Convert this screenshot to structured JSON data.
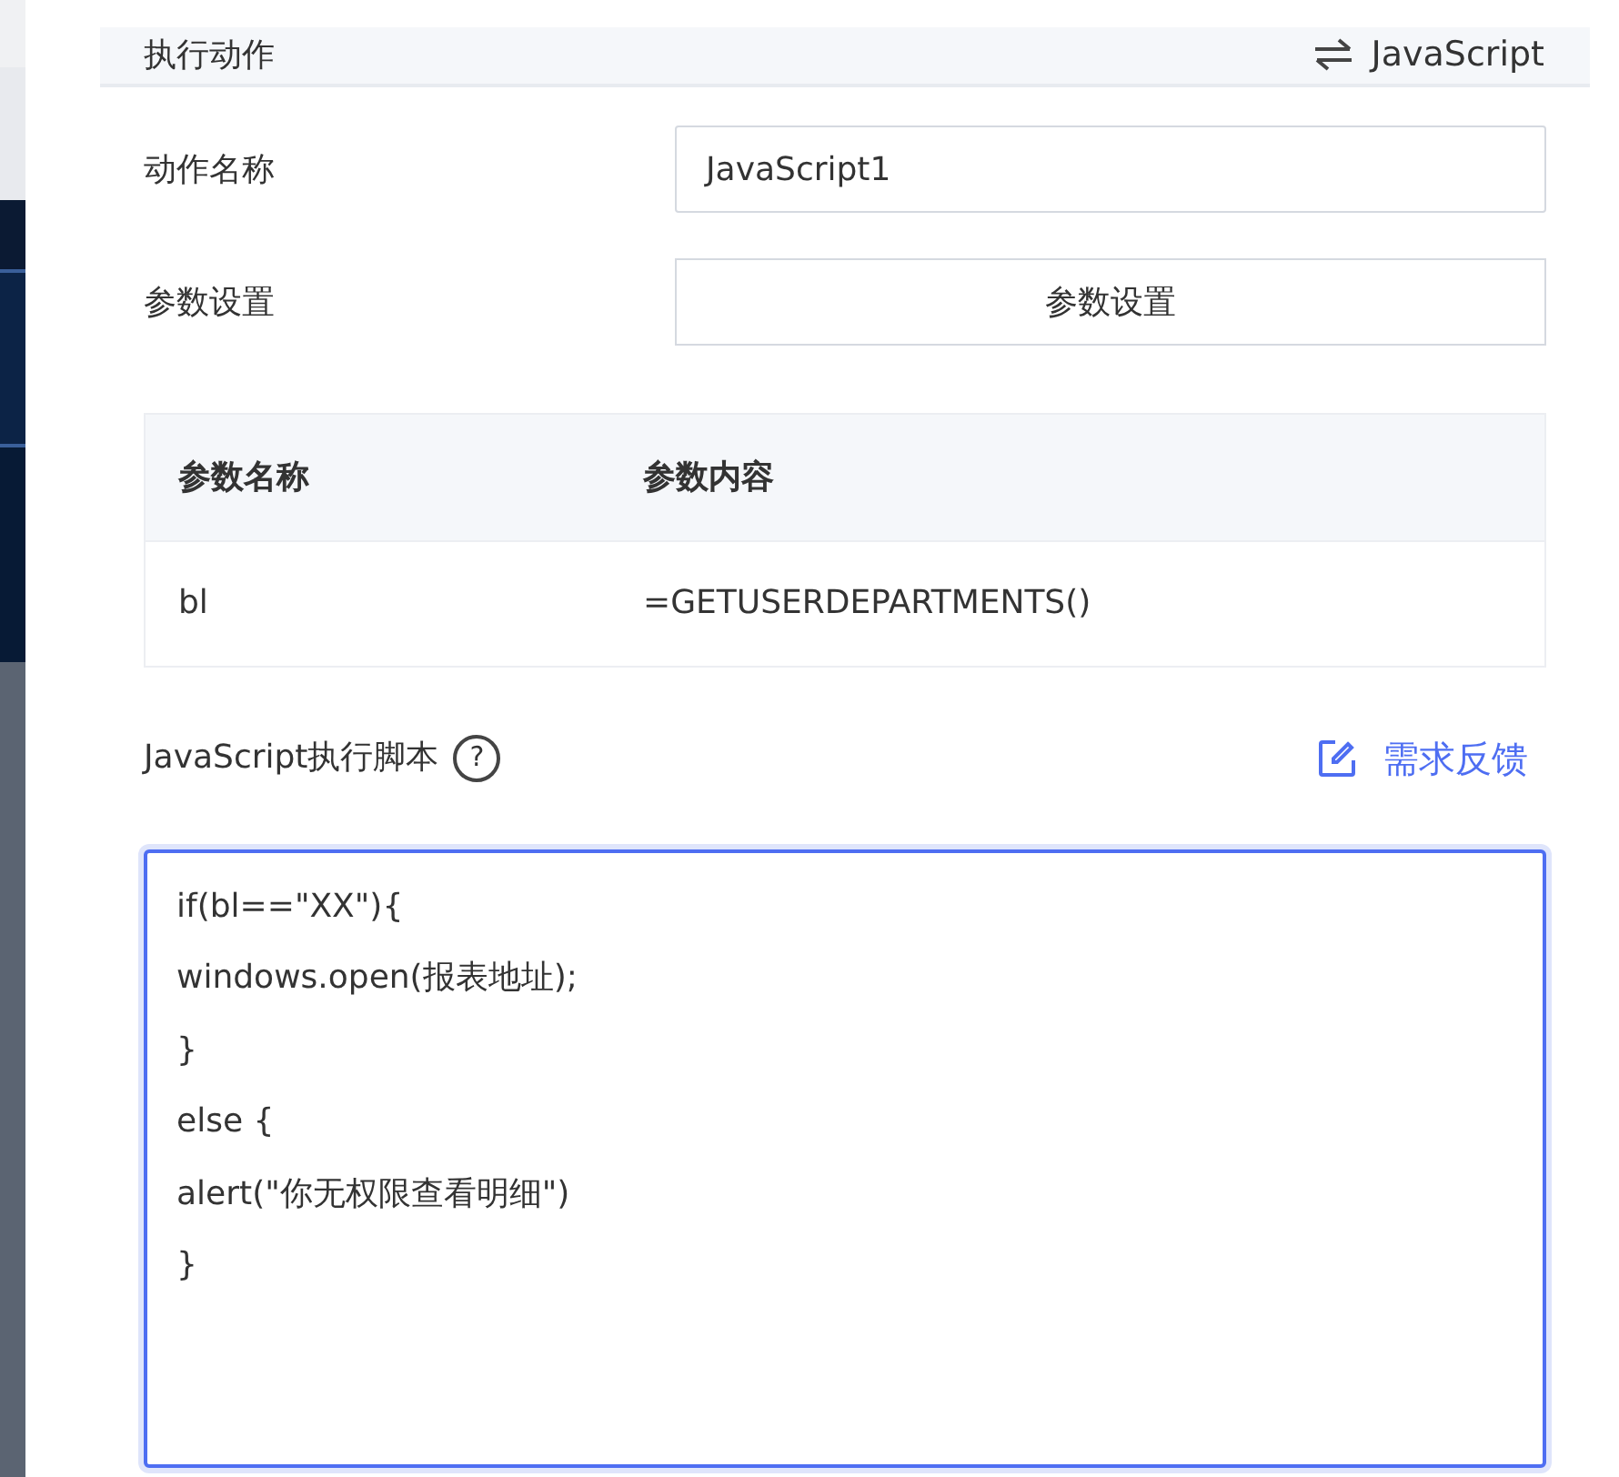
{
  "panel": {
    "title": "执行动作",
    "switch_label": "JavaScript"
  },
  "form": [
    {
      "kind": "input",
      "label": "动作名称",
      "value": "JavaScript1"
    },
    {
      "kind": "button",
      "label": "参数设置",
      "button": "参数设置"
    }
  ],
  "table": {
    "columns": [
      "参数名称",
      "参数内容"
    ],
    "rows": [
      [
        "bl",
        "=GETUSERDEPARTMENTS()"
      ]
    ]
  },
  "script": {
    "label": "JavaScript执行脚本",
    "help": "?",
    "feedback": "需求反馈",
    "value": "if(bl==\"XX\"){\nwindows.open(报表地址);\n}\nelse {\nalert(\"你无权限查看明细\")\n}",
    "focused": true
  }
}
